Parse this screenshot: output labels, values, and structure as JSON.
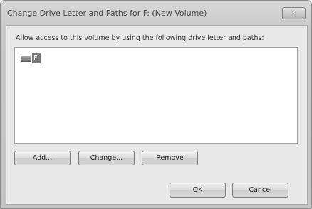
{
  "window": {
    "title": "Change Drive Letter and Paths for F: (New Volume)",
    "close_icon": "close-icon"
  },
  "dialog": {
    "prompt": "Allow access to this volume by using the following drive letter and paths:",
    "paths": [
      {
        "label": "F:",
        "icon": "drive-icon"
      }
    ]
  },
  "buttons": {
    "add": "Add...",
    "change": "Change...",
    "remove": "Remove",
    "ok": "OK",
    "cancel": "Cancel"
  }
}
